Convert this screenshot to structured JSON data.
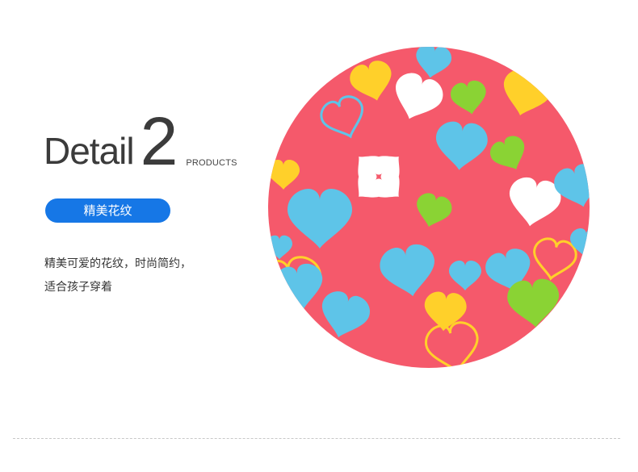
{
  "title": {
    "word": "Detail",
    "number": "2",
    "sub": "PRODUCTS"
  },
  "badge": {
    "label": "精美花纹"
  },
  "description": {
    "lines": [
      "精美可爱的花纹，时尚简约，",
      "适合孩子穿着"
    ]
  },
  "image": {
    "subject": "fabric-pattern-hearts",
    "colors": {
      "background": "#f5596b",
      "blue": "#5ec4e8",
      "white": "#ffffff",
      "green": "#8ad334",
      "yellow": "#ffd02a"
    }
  }
}
